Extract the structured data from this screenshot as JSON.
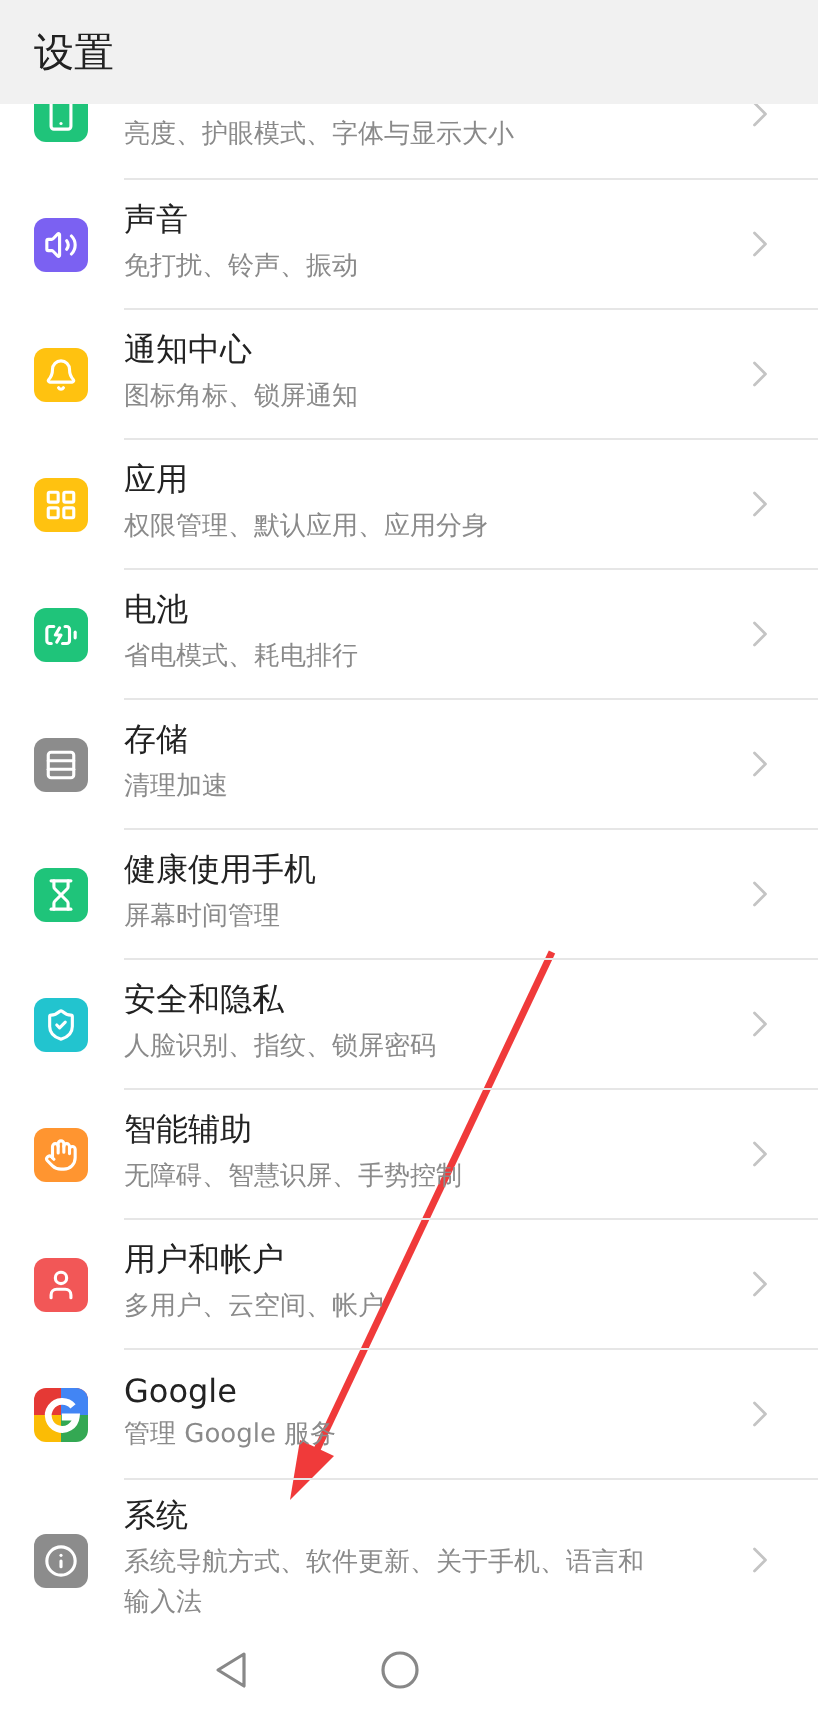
{
  "header": {
    "title": "设置"
  },
  "items": [
    {
      "subtitle": "亮度、护眼模式、字体与显示大小",
      "color": "#1fc47a"
    },
    {
      "title": "声音",
      "subtitle": "免打扰、铃声、振动",
      "color": "#7b61f2"
    },
    {
      "title": "通知中心",
      "subtitle": "图标角标、锁屏通知",
      "color": "#ffc210"
    },
    {
      "title": "应用",
      "subtitle": "权限管理、默认应用、应用分身",
      "color": "#ffc210"
    },
    {
      "title": "电池",
      "subtitle": "省电模式、耗电排行",
      "color": "#1fc47a"
    },
    {
      "title": "存储",
      "subtitle": "清理加速",
      "color": "#8c8c8c"
    },
    {
      "title": "健康使用手机",
      "subtitle": "屏幕时间管理",
      "color": "#1fc47a"
    },
    {
      "title": "安全和隐私",
      "subtitle": "人脸识别、指纹、锁屏密码",
      "color": "#22c4cf"
    },
    {
      "title": "智能辅助",
      "subtitle": "无障碍、智慧识屏、手势控制",
      "color": "#ff9530"
    },
    {
      "title": "用户和帐户",
      "subtitle": "多用户、云空间、帐户",
      "color": "#f25757"
    },
    {
      "title": "Google",
      "subtitle": "管理 Google 服务",
      "color": "#ffffff"
    },
    {
      "title": "系统",
      "subtitle": "系统导航方式、软件更新、关于手机、语言和输入法",
      "color": "#8c8c8c"
    }
  ]
}
